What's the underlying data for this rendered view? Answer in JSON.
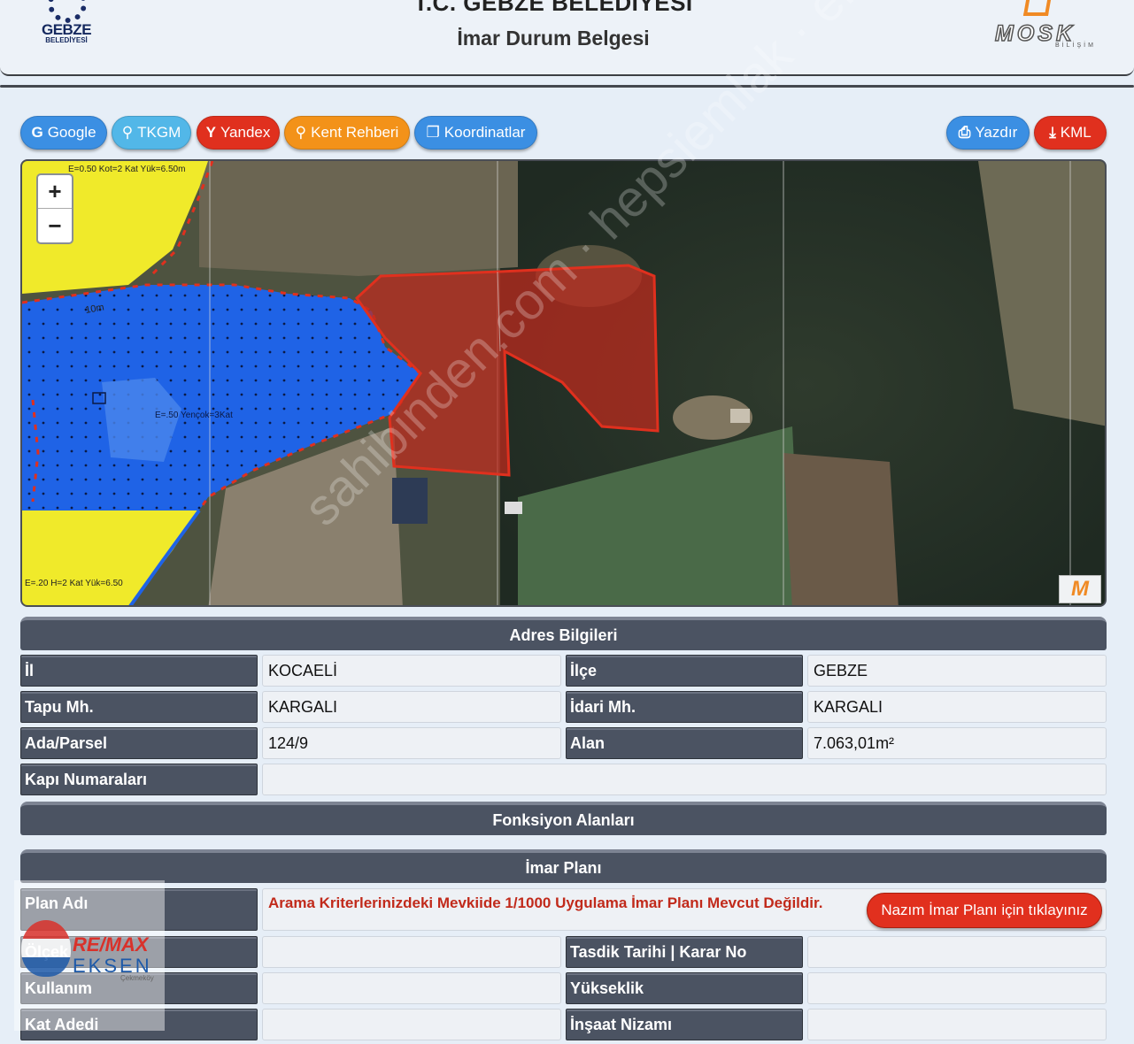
{
  "header": {
    "logo_left_text": "GEBZE",
    "logo_left_sub": "BELEDİYESİ",
    "title": "T.C. GEBZE BELEDİYESİ",
    "subtitle": "İmar Durum Belgesi",
    "logo_right_text": "MOSK",
    "logo_right_sub": "BİLİŞİM"
  },
  "toolbar": {
    "left_buttons": [
      {
        "label": "Google",
        "color": "#3b8fe3"
      },
      {
        "label": "TKGM",
        "color": "#52b7e8"
      },
      {
        "label": "Yandex",
        "color": "#e0301e"
      },
      {
        "label": "Kent Rehberi",
        "color": "#f39219"
      },
      {
        "label": "Koordinatlar",
        "color": "#3b8fe3"
      }
    ],
    "right_buttons": [
      {
        "label": "Yazdır",
        "color": "#3b8fe3"
      },
      {
        "label": "KML",
        "color": "#e0301e"
      }
    ]
  },
  "map": {
    "zoom_in": "+",
    "zoom_out": "−",
    "plan_note_top": "E=0.50 Kot=2 Kat Yük=6.50m",
    "plan_note_mid": "E=.50 Yençok=3Kat",
    "plan_note_bottom": "E=.20 H=2 Kat Yük=6.50",
    "road_label": "10m",
    "logo": "M",
    "parcel_color": "#c0291d",
    "water_zone_color": "#1f63e6",
    "residential_zone_color": "#f0ea2a"
  },
  "watermark": "sahibinden.com · hepsiemlak · emlakjet.com",
  "adres": {
    "section_title": "Adres Bilgileri",
    "il_label": "İl",
    "il_value": "KOCAELİ",
    "ilce_label": "İlçe",
    "ilce_value": "GEBZE",
    "tapu_label": "Tapu Mh.",
    "tapu_value": "KARGALI",
    "idari_label": "İdari Mh.",
    "idari_value": "KARGALI",
    "ada_label": "Ada/Parsel",
    "ada_value": "124/9",
    "alan_label": "Alan",
    "alan_value": "7.063,01m²",
    "kapi_label": "Kapı Numaraları",
    "kapi_value": ""
  },
  "fonksiyon": {
    "section_title": "Fonksiyon Alanları"
  },
  "imar": {
    "section_title": "İmar Planı",
    "plan_adi_label": "Plan Adı",
    "plan_adi_value": "Arama Kriterlerinizdeki Mevkiide 1/1000 Uygulama İmar Planı Mevcut Değildir.",
    "nazim_button": "Nazım İmar Planı için tıklayınız",
    "olcek_label": "Ölçek",
    "tasdik_label": "Tasdik Tarihi | Karar No",
    "kullanim_label": "Kullanım",
    "yukseklik_label": "Yükseklik",
    "kat_label": "Kat Adedi",
    "insaat_label": "İnşaat Nizamı"
  },
  "agency": {
    "name": "RE/MAX",
    "branch": "EKSEN",
    "district": "Çekmeköy"
  }
}
